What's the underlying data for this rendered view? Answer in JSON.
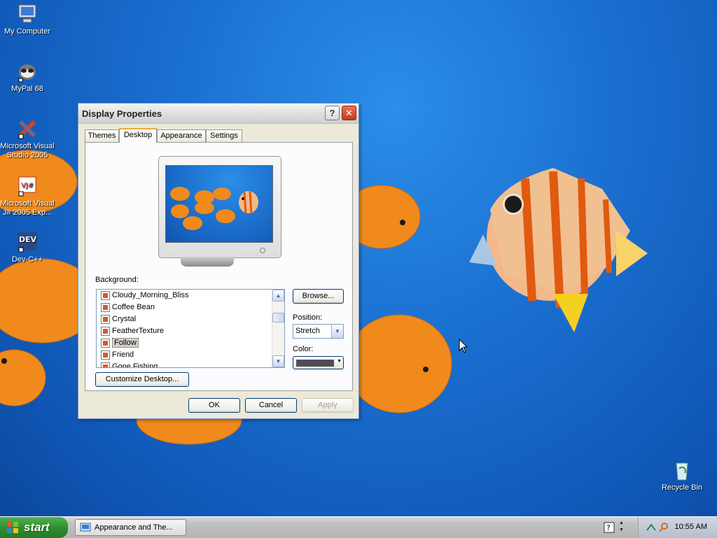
{
  "desktop": {
    "icons": [
      {
        "label": "My Computer"
      },
      {
        "label": "MyPal 68"
      },
      {
        "label": "Microsoft Visual Studio 2005"
      },
      {
        "label": "Microsoft Visual J# 2005 Exp..."
      },
      {
        "label": "Dev-C++"
      },
      {
        "label": "Recycle Bin"
      }
    ]
  },
  "dialog": {
    "title": "Display Properties",
    "help_glyph": "?",
    "close_glyph": "✕",
    "tabs": [
      {
        "label": "Themes"
      },
      {
        "label": "Desktop"
      },
      {
        "label": "Appearance"
      },
      {
        "label": "Settings"
      }
    ],
    "active_tab": "Desktop",
    "background_label": "Background:",
    "background_items": [
      {
        "label": "Cloudy_Morning_Bliss"
      },
      {
        "label": "Coffee Bean"
      },
      {
        "label": "Crystal"
      },
      {
        "label": "FeatherTexture"
      },
      {
        "label": "Follow"
      },
      {
        "label": "Friend"
      },
      {
        "label": "Gone Fishing"
      }
    ],
    "selected_background": "Follow",
    "browse_label": "Browse...",
    "position_label": "Position:",
    "position_value": "Stretch",
    "color_label": "Color:",
    "color_value": "#4f4b5a",
    "customize_label": "Customize Desktop...",
    "ok_label": "OK",
    "cancel_label": "Cancel",
    "apply_label": "Apply"
  },
  "taskbar": {
    "start_label": "start",
    "task_item_label": "Appearance and The...",
    "clock": "10:55 AM"
  }
}
